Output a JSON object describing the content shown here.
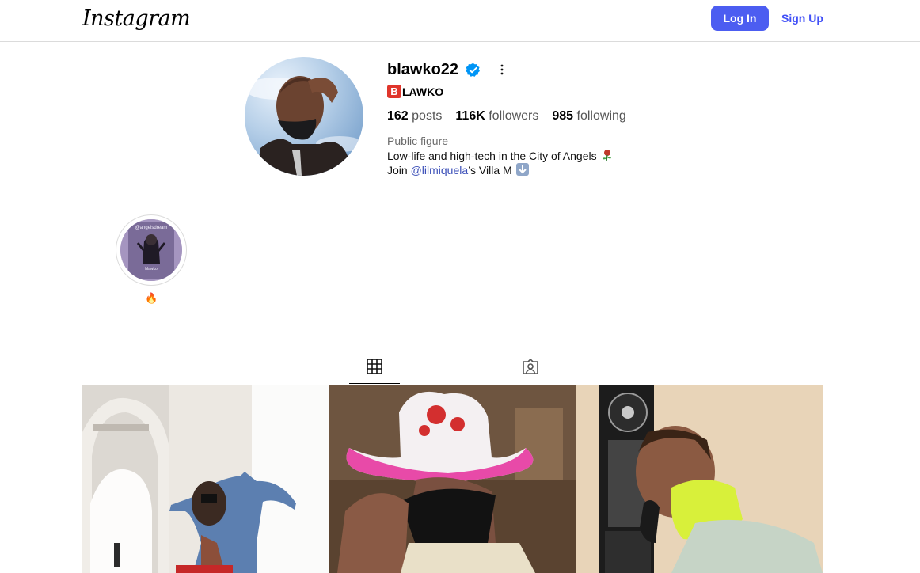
{
  "nav": {
    "logo_text": "Instagram",
    "login_label": "Log In",
    "signup_label": "Sign Up",
    "accent_color": "#4c5df1"
  },
  "profile": {
    "username": "blawko22",
    "verified": true,
    "fullname_badge": "B",
    "fullname_rest": "LAWKO",
    "stats": {
      "posts_count": "162",
      "posts_label": "posts",
      "followers_count": "116K",
      "followers_label": "followers",
      "following_count": "985",
      "following_label": "following"
    },
    "category": "Public figure",
    "bio_line1": "Low-life and high-tech in the City of Angels",
    "bio_line1_emoji": "rose-icon",
    "bio_line2_prefix": "Join ",
    "bio_line2_mention": "@lilmiquela",
    "bio_line2_suffix": "’s Villa M",
    "bio_line2_emoji": "down-arrow-icon"
  },
  "highlights": [
    {
      "label": "🔥",
      "cover_text_top": "@angelsdream",
      "cover_text_bottom": "blawko"
    }
  ],
  "tabs": [
    {
      "name": "posts",
      "icon": "grid-icon",
      "active": true
    },
    {
      "name": "tagged",
      "icon": "tagged-icon",
      "active": false
    }
  ],
  "posts": [
    {
      "icon": "photo-arms-outstretched"
    },
    {
      "icon": "photo-pink-cowboy-hat"
    },
    {
      "icon": "photo-payphone"
    }
  ]
}
